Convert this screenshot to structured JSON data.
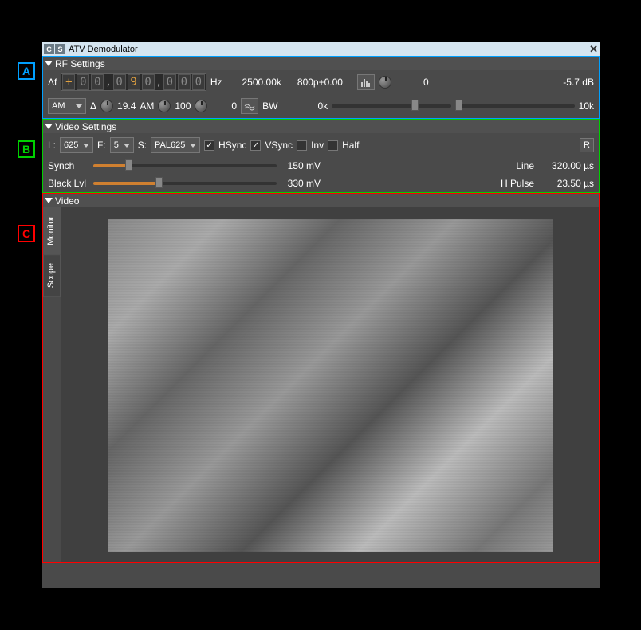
{
  "markers": {
    "a": "A",
    "b": "B",
    "c": "C"
  },
  "titlebar": {
    "c": "C",
    "s": "S",
    "title": "ATV Demodulator"
  },
  "rf": {
    "header": "RF Settings",
    "delta_f": "Δf",
    "digits": [
      "+",
      "0",
      "0",
      "0",
      "9",
      "0",
      "0",
      "0",
      "0"
    ],
    "hz": "Hz",
    "rate": "2500.00k",
    "bp": "800p+0.00",
    "val0": "0",
    "db": "-5.7 dB",
    "mod": "AM",
    "delta": "Δ",
    "knob1": "19.4",
    "am2": "AM",
    "knob2": "100",
    "knob3": "0",
    "bw": "BW",
    "bw_lo": "0k",
    "bw_hi": "10k"
  },
  "video_settings": {
    "header": "Video Settings",
    "l": "L:",
    "l_val": "625",
    "f": "F:",
    "f_val": "5",
    "s": "S:",
    "s_val": "PAL625",
    "hsync": "HSync",
    "vsync": "VSync",
    "inv": "Inv",
    "half": "Half",
    "r": "R",
    "synch": "Synch",
    "synch_val": "150 mV",
    "blacklvl": "Black Lvl",
    "blacklvl_val": "330 mV",
    "line": "Line",
    "line_val": "320.00 µs",
    "hpulse": "H Pulse",
    "hpulse_val": "23.50 µs"
  },
  "video": {
    "header": "Video",
    "tab_monitor": "Monitor",
    "tab_scope": "Scope"
  }
}
